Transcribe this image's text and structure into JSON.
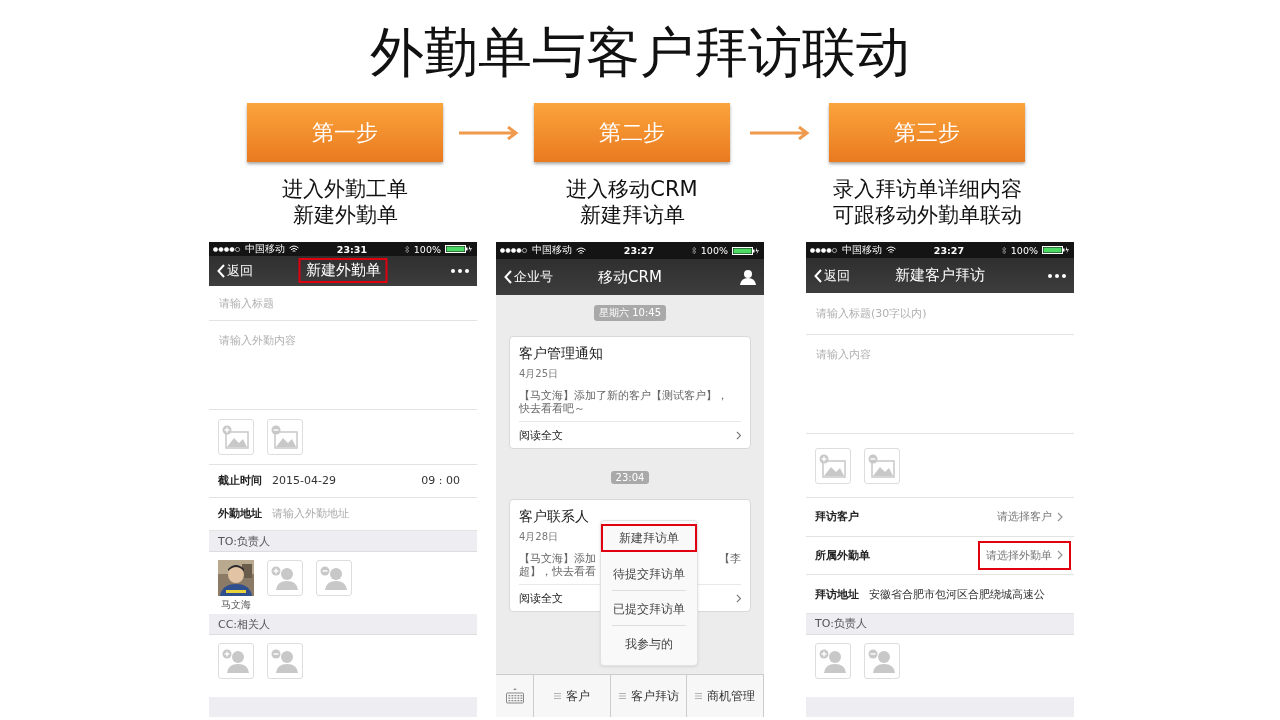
{
  "title": "外勤单与客户拜访联动",
  "steps": [
    {
      "label": "第一步",
      "caption": [
        "进入外勤工单",
        "新建外勤单"
      ]
    },
    {
      "label": "第二步",
      "caption": [
        "进入移动CRM",
        "新建拜访单"
      ]
    },
    {
      "label": "第三步",
      "caption": [
        "录入拜访单详细内容",
        "可跟移动外勤单联动"
      ]
    }
  ],
  "phones": [
    {
      "kind": "form",
      "status": {
        "carrier": "中国移动",
        "time": "23:31",
        "battery": "100%"
      },
      "nav": {
        "back": "返回",
        "title": {
          "text": "新建外勤单",
          "highlighted": true
        }
      },
      "title_placeholder": "请输入标题",
      "content_placeholder": "请输入外勤内容",
      "rows": [
        {
          "kind": "date",
          "label": "截止时间",
          "value": "2015-04-29",
          "extra": "09 : 00"
        },
        {
          "kind": "input",
          "label": "外勤地址",
          "placeholder": "请输入外勤地址"
        }
      ],
      "sections": [
        {
          "header": "TO:负责人",
          "people": [
            {
              "name": "马文海"
            }
          ]
        },
        {
          "header": "CC:相关人"
        }
      ]
    },
    {
      "kind": "chat",
      "status": {
        "carrier": "中国移动",
        "time": "23:27",
        "battery": "100%"
      },
      "nav": {
        "back": "企业号",
        "title": {
          "text": "移动CRM",
          "highlighted": false
        }
      },
      "messages": [
        {
          "kind": "time",
          "text": "星期六 10:45"
        },
        {
          "kind": "card",
          "title": "客户管理通知",
          "date": "4月25日",
          "body": [
            "【马文海】添加了新的客户【测试客户】，",
            "快去看看吧～"
          ],
          "link": "阅读全文"
        },
        {
          "kind": "time",
          "text": "23:04"
        },
        {
          "kind": "card",
          "title": "客户联系人",
          "date": "4月28日",
          "body": [
            "【马文海】添加",
            "超】，快去看看"
          ],
          "body_right": "【李",
          "link": "阅读全文"
        }
      ],
      "menu": [
        {
          "label": "新建拜访单",
          "highlighted": true
        },
        {
          "label": "待提交拜访单",
          "highlighted": false
        },
        {
          "label": "已提交拜访单",
          "highlighted": false
        },
        {
          "label": "我参与的",
          "highlighted": false
        }
      ],
      "tabs": [
        {
          "label": "客户"
        },
        {
          "label": "客户拜访"
        },
        {
          "label": "商机管理"
        }
      ]
    },
    {
      "kind": "form",
      "status": {
        "carrier": "中国移动",
        "time": "23:27",
        "battery": "100%"
      },
      "nav": {
        "back": "返回",
        "title": {
          "text": "新建客户拜访",
          "highlighted": false
        }
      },
      "title_placeholder": "请输入标题(30字以内)",
      "content_placeholder": "请输入内容",
      "rows": [
        {
          "kind": "select",
          "label": "拜访客户",
          "placeholder": "请选择客户",
          "highlighted": false
        },
        {
          "kind": "select",
          "label": "所属外勤单",
          "placeholder": "请选择外勤单",
          "highlighted": true
        },
        {
          "kind": "text",
          "label": "拜访地址",
          "value": "安徽省合肥市包河区合肥绕城高速公"
        }
      ],
      "sections": [
        {
          "header": "TO:负责人"
        }
      ]
    }
  ]
}
